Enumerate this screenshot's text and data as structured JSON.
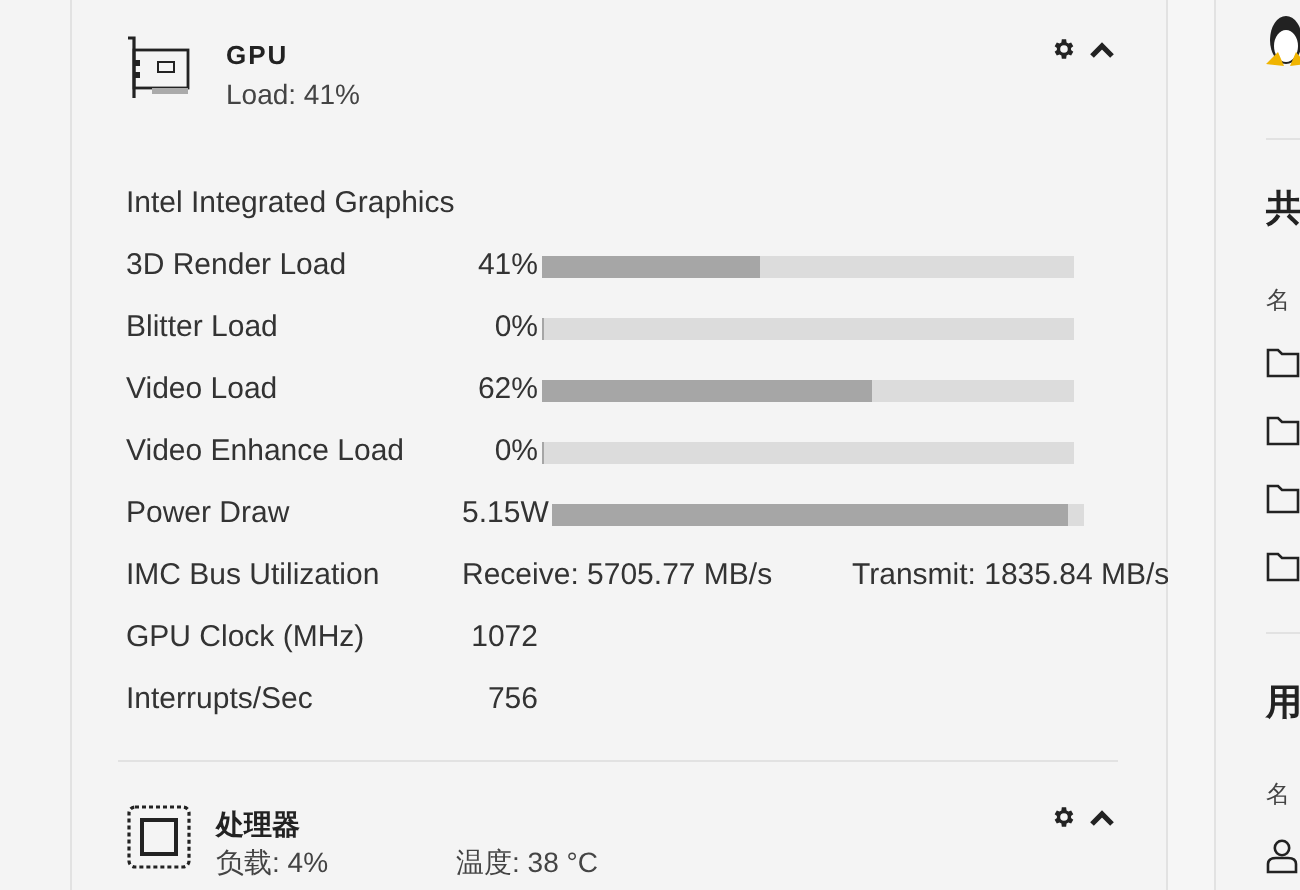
{
  "gpu_card": {
    "title": "GPU",
    "subtitle": "Load: 41%",
    "expanded": true,
    "device": "Intel Integrated Graphics",
    "metrics": [
      {
        "kind": "bar",
        "label": "3D Render Load",
        "value": "41%",
        "level": 0.41
      },
      {
        "kind": "bar",
        "label": "Blitter Load",
        "value": "0%",
        "level": 0
      },
      {
        "kind": "bar",
        "label": "Video Load",
        "value": "62%",
        "level": 0.62
      },
      {
        "kind": "bar",
        "label": "Video Enhance Load",
        "value": "0%",
        "level": 0
      },
      {
        "kind": "bar",
        "label": "Power Draw",
        "value": "5.15W",
        "level": 0.97
      },
      {
        "kind": "pair",
        "label": "IMC Bus Utilization",
        "values": [
          "Receive: 5705.77 MB/s",
          "Transmit: 1835.84 MB/s"
        ]
      },
      {
        "kind": "text",
        "label": "GPU Clock (MHz)",
        "value": "1072"
      },
      {
        "kind": "text",
        "label": "Interrupts/Sec",
        "value": "756"
      }
    ]
  },
  "cpu_card": {
    "title": "处理器",
    "load": "负载: 4%",
    "temperature": "温度: 38 °C",
    "expanded": true
  },
  "side_panel": {
    "sections": [
      {
        "heading": "共",
        "column_label": "名",
        "rows": [
          {
            "kind": "folder"
          },
          {
            "kind": "folder"
          },
          {
            "kind": "folder"
          },
          {
            "kind": "folder"
          }
        ]
      },
      {
        "heading": "用",
        "column_label": "名",
        "rows": [
          {
            "kind": "user"
          }
        ]
      }
    ]
  }
}
